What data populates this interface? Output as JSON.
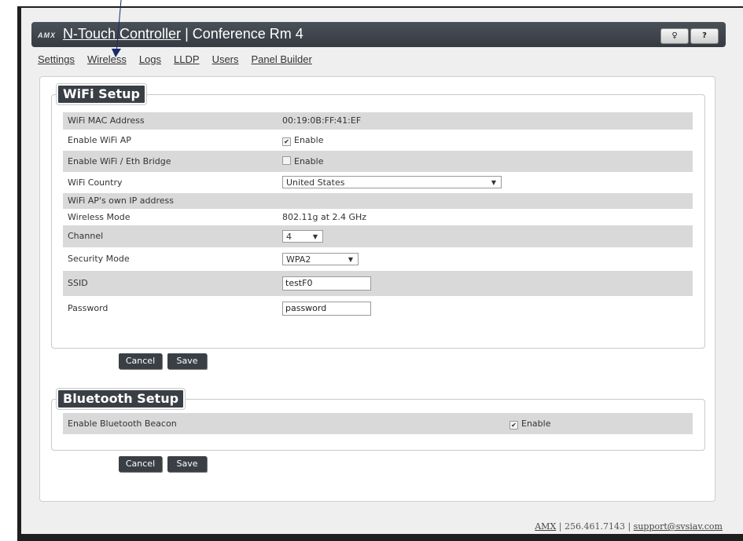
{
  "header": {
    "brand": "AMX",
    "title_link": "N-Touch Controller",
    "title_rest": " | Conference Rm 4",
    "user_btn": "♀",
    "help_btn": "?"
  },
  "nav": {
    "items": [
      "Settings",
      "Wireless",
      "Logs",
      "LLDP",
      "Users",
      "Panel Builder"
    ]
  },
  "wifi": {
    "legend": "WiFi Setup",
    "mac_label": "WiFi MAC Address",
    "mac_value": "00:19:0B:FF:41:EF",
    "ap_label": "Enable WiFi AP",
    "ap_enable": "Enable",
    "ap_checked": true,
    "bridge_label": "Enable WiFi / Eth Bridge",
    "bridge_enable": "Enable",
    "bridge_checked": false,
    "country_label": "WiFi Country",
    "country_value": "United States",
    "ip_label": "WiFi AP's own IP address",
    "mode_label": "Wireless Mode",
    "mode_value": "802.11g at 2.4 GHz",
    "channel_label": "Channel",
    "channel_value": "4",
    "security_label": "Security Mode",
    "security_value": "WPA2",
    "ssid_label": "SSID",
    "ssid_value": "testF0",
    "password_label": "Password",
    "password_value": "password",
    "cancel": "Cancel",
    "save": "Save"
  },
  "bluetooth": {
    "legend": "Bluetooth Setup",
    "beacon_label": "Enable Bluetooth Beacon",
    "beacon_enable": "Enable",
    "beacon_checked": true,
    "cancel": "Cancel",
    "save": "Save"
  },
  "footer": {
    "company": "AMX",
    "phone": " | 256.461.7143 | ",
    "email": "support@svsiav.com"
  }
}
